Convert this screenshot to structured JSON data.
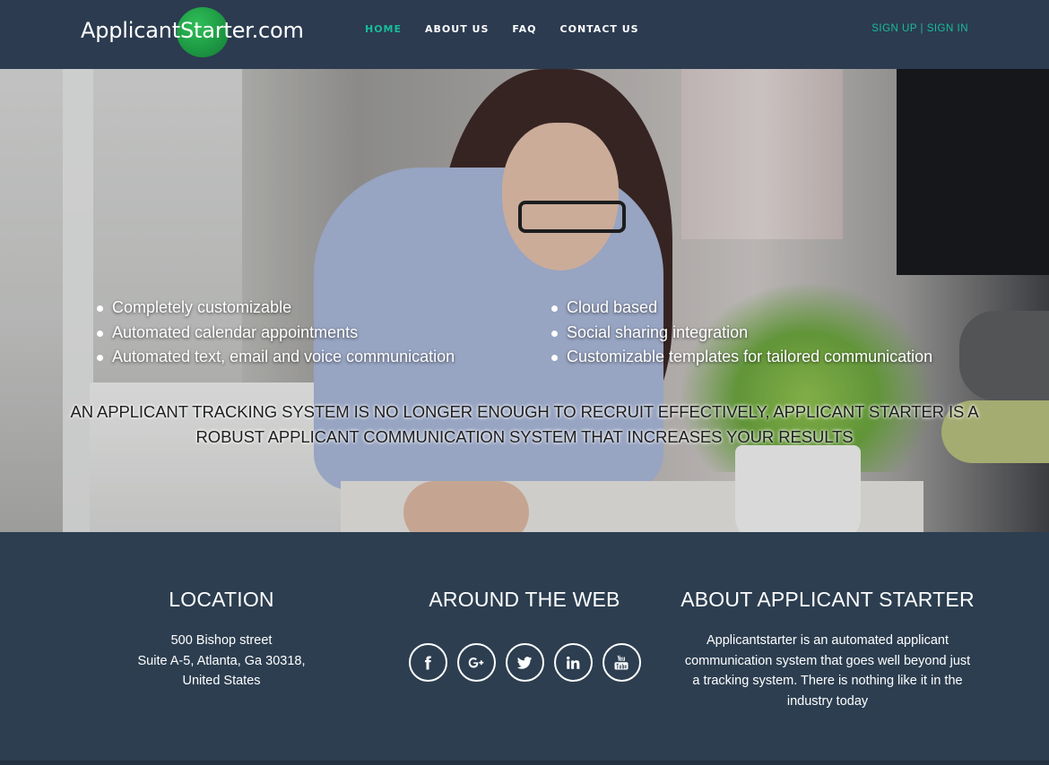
{
  "header": {
    "logo_text": "ApplicantStarter.com",
    "nav": [
      {
        "label": "HOME",
        "active": true
      },
      {
        "label": "ABOUT US",
        "active": false
      },
      {
        "label": "FAQ",
        "active": false
      },
      {
        "label": "CONTACT US",
        "active": false
      }
    ],
    "sign_up": "SIGN UP",
    "separator": " | ",
    "sign_in": "SIGN IN"
  },
  "hero": {
    "features_left": [
      "Completely customizable",
      "Automated calendar appointments",
      "Automated text, email and voice communication"
    ],
    "features_right": [
      "Cloud based",
      "Social sharing integration",
      "Customizable templates for tailored communication"
    ],
    "tagline": "AN APPLICANT TRACKING SYSTEM IS NO LONGER ENOUGH TO RECRUIT EFFECTIVELY, APPLICANT STARTER IS A ROBUST APPLICANT COMMUNICATION SYSTEM THAT INCREASES YOUR RESULTS"
  },
  "footer": {
    "location": {
      "title": "LOCATION",
      "line1": "500 Bishop street",
      "line2": "Suite A-5, Atlanta, Ga 30318,",
      "line3": "United States"
    },
    "web": {
      "title": "AROUND THE WEB",
      "icons": [
        "facebook-icon",
        "google-plus-icon",
        "twitter-icon",
        "linkedin-icon",
        "youtube-icon"
      ]
    },
    "about": {
      "title": "ABOUT APPLICANT STARTER",
      "text": "Applicantstarter is an automated applicant communication system that goes well beyond just a tracking system. There is nothing like it in the industry today"
    }
  },
  "colors": {
    "nav_bg": "#2c3b50",
    "accent": "#18bc9c",
    "footer_bg": "#2c3e50",
    "logo_circle": "#1e9a44"
  }
}
